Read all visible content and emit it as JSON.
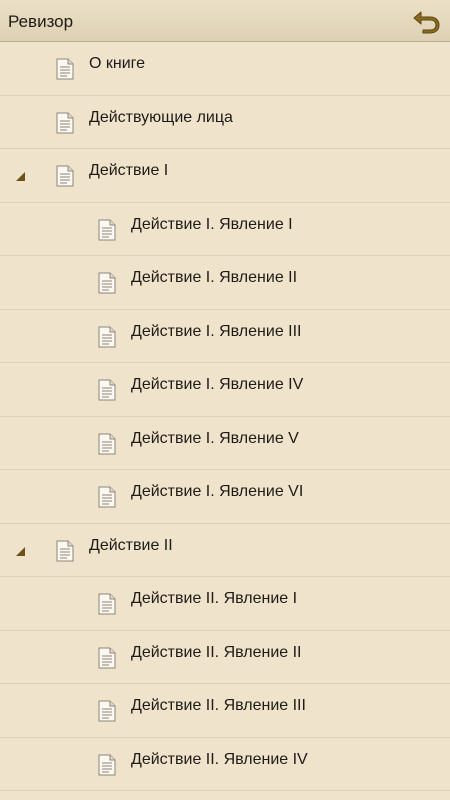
{
  "app_bar": {
    "title": "Ревизор",
    "back_icon": "undo-arrow-icon",
    "accent_color": "#8a6a1e"
  },
  "toc": [
    {
      "label": "О книге",
      "level": 1,
      "expandable": false
    },
    {
      "label": "Действующие лица",
      "level": 1,
      "expandable": false
    },
    {
      "label": "Действие I",
      "level": 1,
      "expandable": true,
      "expanded": true
    },
    {
      "label": "Действие I. Явление I",
      "level": 2,
      "expandable": false
    },
    {
      "label": "Действие I. Явление II",
      "level": 2,
      "expandable": false
    },
    {
      "label": "Действие I. Явление III",
      "level": 2,
      "expandable": false
    },
    {
      "label": "Действие I. Явление IV",
      "level": 2,
      "expandable": false
    },
    {
      "label": "Действие I. Явление V",
      "level": 2,
      "expandable": false
    },
    {
      "label": "Действие I. Явление VI",
      "level": 2,
      "expandable": false
    },
    {
      "label": "Действие II",
      "level": 1,
      "expandable": true,
      "expanded": true
    },
    {
      "label": "Действие II. Явление I",
      "level": 2,
      "expandable": false
    },
    {
      "label": "Действие II. Явление II",
      "level": 2,
      "expandable": false
    },
    {
      "label": "Действие II. Явление III",
      "level": 2,
      "expandable": false
    },
    {
      "label": "Действие II. Явление IV",
      "level": 2,
      "expandable": false
    }
  ],
  "item_icon": "document-page-icon",
  "expander_icon": "expanded-triangle-icon"
}
